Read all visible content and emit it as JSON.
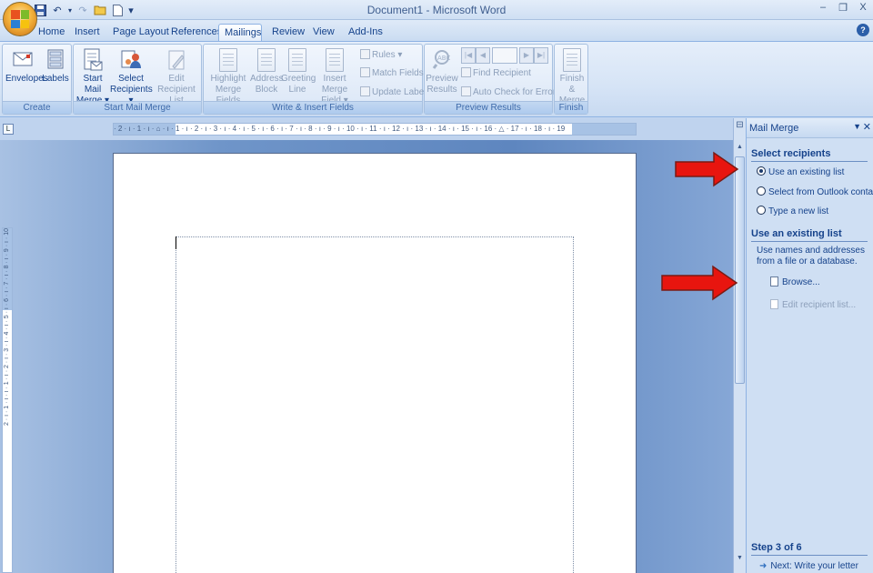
{
  "window": {
    "title": "Document1 - Microsoft Word",
    "controls": [
      "–",
      "❐",
      "X"
    ]
  },
  "quick_access": {
    "customize": "▾"
  },
  "tabs": [
    {
      "label": "Home"
    },
    {
      "label": "Insert"
    },
    {
      "label": "Page Layout"
    },
    {
      "label": "References"
    },
    {
      "label": "Mailings",
      "active": true
    },
    {
      "label": "Review"
    },
    {
      "label": "View"
    },
    {
      "label": "Add-Ins"
    }
  ],
  "help": "?",
  "ribbon": {
    "create": {
      "label": "Create",
      "envelopes": "Envelopes",
      "labels": "Labels"
    },
    "start_mail_merge": {
      "label": "Start Mail Merge",
      "start_line1": "Start Mail",
      "start_line2": "Merge ▾",
      "select_line1": "Select",
      "select_line2": "Recipients ▾",
      "edit_line1": "Edit",
      "edit_line2": "Recipient List"
    },
    "write_insert": {
      "label": "Write & Insert Fields",
      "highlight_line1": "Highlight",
      "highlight_line2": "Merge Fields",
      "address_line1": "Address",
      "address_line2": "Block",
      "greeting_line1": "Greeting",
      "greeting_line2": "Line",
      "insert_line1": "Insert Merge",
      "insert_line2": "Field ▾",
      "rules": "Rules ▾",
      "match_fields": "Match Fields",
      "update_labels": "Update Labels"
    },
    "preview": {
      "label": "Preview Results",
      "preview_line1": "Preview",
      "preview_line2": "Results",
      "find_recipient": "Find Recipient",
      "auto_check": "Auto Check for Errors"
    },
    "finish": {
      "label": "Finish",
      "finish_line1": "Finish &",
      "finish_line2": "Merge ▾"
    }
  },
  "ruler": {
    "tab_selector": "L",
    "marks": "· 2 · ı · 1 · ı · ⌂ · ı · 1 · ı · 2 · ı · 3 · ı · 4 · ı · 5 · ı · 6 · ı · 7 · ı · 8 · ı · 9 · ı · 10 · ı · 11 · ı · 12 · ı · 13 · ı · 14 · ı · 15 · ı · 16 · △ · 17 · ı · 18 · ı · 19",
    "vertical_marks": "2 · ı · 1 · ı · ı · 1 · ı · 2 · ı · 3 · ı · 4 · ı · 5 · ı · 6 · ı · 7 · ı · 8 · ı · 9 · ı · 10"
  },
  "scrollbar": {
    "up": "▲",
    "down": "▼"
  },
  "task_pane": {
    "title": "Mail Merge",
    "menu": "▼",
    "close": "✕",
    "select_recipients_heading": "Select recipients",
    "options": [
      {
        "label": "Use an existing list",
        "selected": true
      },
      {
        "label": "Select from Outlook contacts",
        "selected": false
      },
      {
        "label": "Type a new list",
        "selected": false
      }
    ],
    "existing_heading": "Use an existing list",
    "description": "Use names and addresses from a file or a database.",
    "browse": "Browse...",
    "edit_list": "Edit recipient list...",
    "step": "Step 3 of 6",
    "next": "Next: Write your letter"
  },
  "colors": {
    "annotation_arrow": "#e8150f",
    "ribbon_text": "#15428b",
    "doc_background": "#5e86bf"
  }
}
